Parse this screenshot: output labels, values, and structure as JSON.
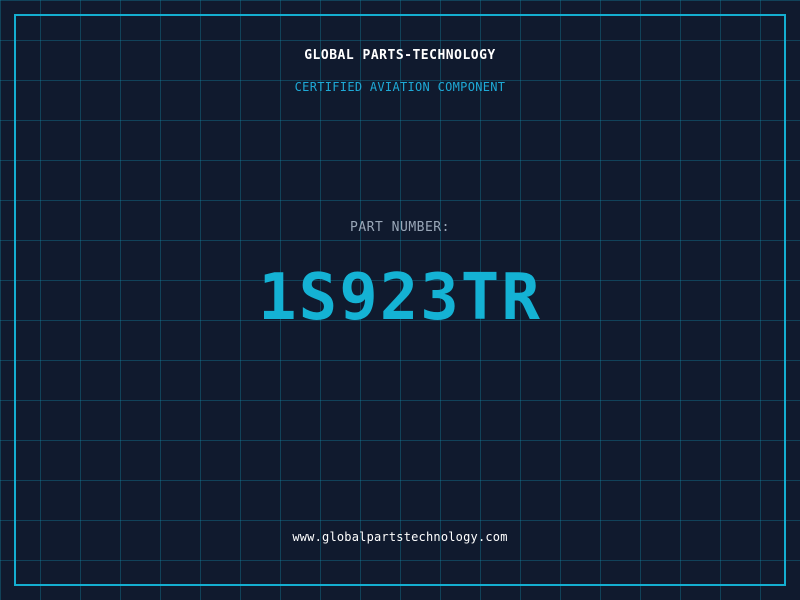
{
  "header": {
    "company": "GLOBAL PARTS-TECHNOLOGY",
    "subtitle": "CERTIFIED AVIATION COMPONENT"
  },
  "part": {
    "label": "PART NUMBER:",
    "number": "1S923TR"
  },
  "footer": {
    "website": "www.globalpartstechnology.com"
  },
  "colors": {
    "background": "#101a2e",
    "grid": "#148caa",
    "accent": "#14b2d4",
    "text": "#ffffff",
    "muted": "#9aa7b8"
  }
}
